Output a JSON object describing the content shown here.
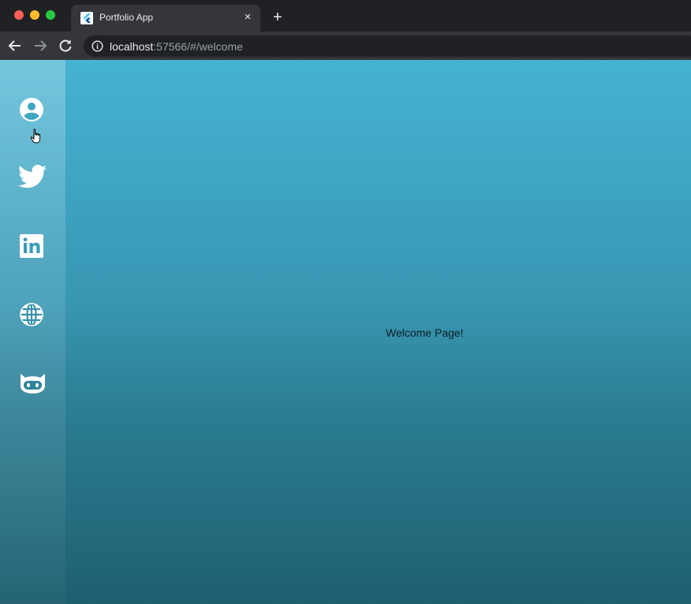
{
  "browser": {
    "tab": {
      "title": "Portfolio App",
      "close_glyph": "×"
    },
    "new_tab_glyph": "+",
    "address": {
      "host": "localhost",
      "rest": ":57566/#/welcome"
    }
  },
  "sidebar": {
    "items": [
      {
        "name": "profile",
        "icon": "account-circle-icon"
      },
      {
        "name": "twitter",
        "icon": "twitter-icon"
      },
      {
        "name": "linkedin",
        "icon": "linkedin-icon"
      },
      {
        "name": "website",
        "icon": "globe-icon"
      },
      {
        "name": "github",
        "icon": "github-icon"
      }
    ]
  },
  "main": {
    "message": "Welcome Page!"
  },
  "colors": {
    "accent_top": "#45b3d2",
    "accent_bottom": "#1f5f70",
    "icon": "#ffffff"
  }
}
